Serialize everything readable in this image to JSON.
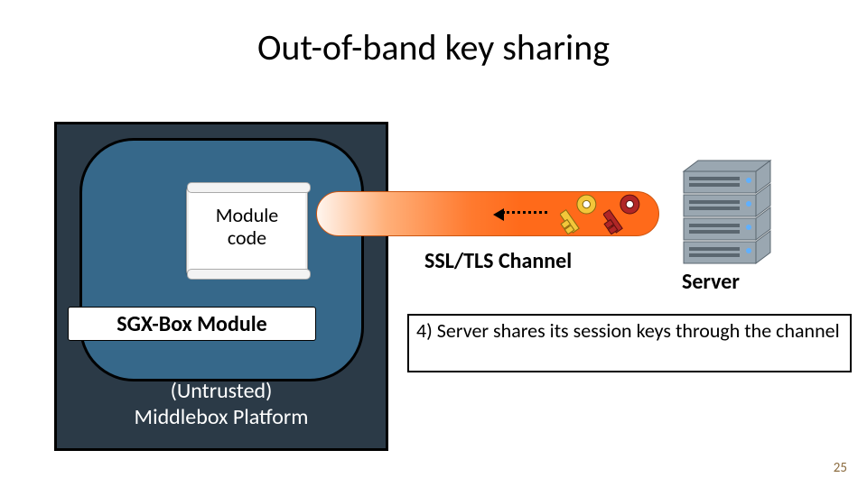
{
  "title": "Out-of-band key sharing",
  "module": {
    "code_label": "Module\ncode",
    "name_label": "SGX-Box Module"
  },
  "platform_label": "(Untrusted)\nMiddlebox Platform",
  "channel_label": "SSL/TLS Channel",
  "server_label": "Server",
  "caption": "4) Server shares its session keys through the channel",
  "page_number": "25",
  "colors": {
    "key_yellow": "#f3c63a",
    "key_red": "#b02626"
  }
}
